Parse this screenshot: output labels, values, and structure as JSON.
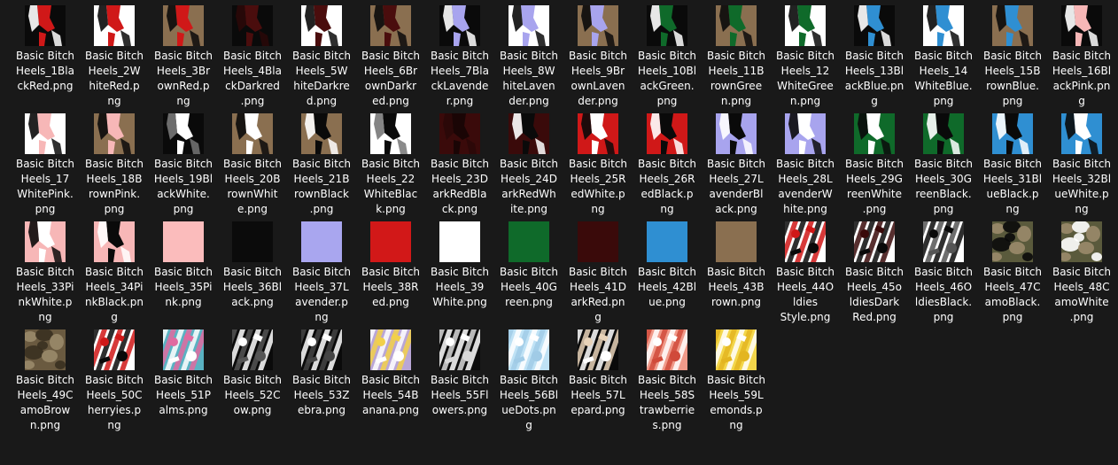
{
  "files": [
    {
      "name": "Basic Bitch Heels_1BlackRed.png",
      "lines": [
        "Basic Bitch",
        "Heels_1Bla",
        "ckRed.png"
      ],
      "thumb": {
        "kind": "shoe",
        "bg": "#0a0a0a",
        "a": "#d01818",
        "b": "#ffffff"
      }
    },
    {
      "name": "Basic Bitch Heels_2WhiteRed.png",
      "lines": [
        "Basic Bitch",
        "Heels_2W",
        "hiteRed.p",
        "ng"
      ],
      "thumb": {
        "kind": "shoe",
        "bg": "#ffffff",
        "a": "#d01818",
        "b": "#0a0a0a"
      }
    },
    {
      "name": "Basic Bitch Heels_3BrownRed.png",
      "lines": [
        "Basic Bitch",
        "Heels_3Br",
        "ownRed.p",
        "ng"
      ],
      "thumb": {
        "kind": "shoe",
        "bg": "#8a6f50",
        "a": "#d01818",
        "b": "#0a0a0a"
      }
    },
    {
      "name": "Basic Bitch Heels_4BlackDarkred.png",
      "lines": [
        "Basic Bitch",
        "Heels_4Bla",
        "ckDarkred",
        ".png"
      ],
      "thumb": {
        "kind": "shoe",
        "bg": "#0a0a0a",
        "a": "#4a0d0d",
        "b": "#2a0808"
      }
    },
    {
      "name": "Basic Bitch Heels_5WhiteDarkred.png",
      "lines": [
        "Basic Bitch",
        "Heels_5W",
        "hiteDarkre",
        "d.png"
      ],
      "thumb": {
        "kind": "shoe",
        "bg": "#ffffff",
        "a": "#4a0d0d",
        "b": "#0a0a0a"
      }
    },
    {
      "name": "Basic Bitch Heels_6BrownDarkred.png",
      "lines": [
        "Basic Bitch",
        "Heels_6Br",
        "ownDarkr",
        "ed.png"
      ],
      "thumb": {
        "kind": "shoe",
        "bg": "#8a6f50",
        "a": "#4a0d0d",
        "b": "#0a0a0a"
      }
    },
    {
      "name": "Basic Bitch Heels_7BlackLavender.png",
      "lines": [
        "Basic Bitch",
        "Heels_7Bla",
        "ckLavende",
        "r.png"
      ],
      "thumb": {
        "kind": "shoe",
        "bg": "#0a0a0a",
        "a": "#a8a4ee",
        "b": "#ffffff"
      }
    },
    {
      "name": "Basic Bitch Heels_8WhiteLavender.png",
      "lines": [
        "Basic Bitch",
        "Heels_8W",
        "hiteLaven",
        "der.png"
      ],
      "thumb": {
        "kind": "shoe",
        "bg": "#ffffff",
        "a": "#a8a4ee",
        "b": "#0a0a0a"
      }
    },
    {
      "name": "Basic Bitch Heels_9BrownLavender.png",
      "lines": [
        "Basic Bitch",
        "Heels_9Br",
        "ownLaven",
        "der.png"
      ],
      "thumb": {
        "kind": "shoe",
        "bg": "#8a6f50",
        "a": "#a8a4ee",
        "b": "#0a0a0a"
      }
    },
    {
      "name": "Basic Bitch Heels_10BlackGreen.png",
      "lines": [
        "Basic Bitch",
        "Heels_10Bl",
        "ackGreen.",
        "png"
      ],
      "thumb": {
        "kind": "shoe",
        "bg": "#0a0a0a",
        "a": "#0f6a2a",
        "b": "#ffffff"
      }
    },
    {
      "name": "Basic Bitch Heels_11BrownGreen.png",
      "lines": [
        "Basic Bitch",
        "Heels_11B",
        "rownGree",
        "n.png"
      ],
      "thumb": {
        "kind": "shoe",
        "bg": "#8a6f50",
        "a": "#0f6a2a",
        "b": "#0a0a0a"
      }
    },
    {
      "name": "Basic Bitch Heels_12WhiteGreen.png",
      "lines": [
        "Basic Bitch",
        "Heels_12",
        "WhiteGree",
        "n.png"
      ],
      "thumb": {
        "kind": "shoe",
        "bg": "#ffffff",
        "a": "#0f6a2a",
        "b": "#0a0a0a"
      }
    },
    {
      "name": "Basic Bitch Heels_13BlackBlue.png",
      "lines": [
        "Basic Bitch",
        "Heels_13Bl",
        "ackBlue.pn",
        "g"
      ],
      "thumb": {
        "kind": "shoe",
        "bg": "#0a0a0a",
        "a": "#2f8fd2",
        "b": "#ffffff"
      }
    },
    {
      "name": "Basic Bitch Heels_14WhiteBlue.png",
      "lines": [
        "Basic Bitch",
        "Heels_14",
        "WhiteBlue.",
        "png"
      ],
      "thumb": {
        "kind": "shoe",
        "bg": "#ffffff",
        "a": "#2f8fd2",
        "b": "#0a0a0a"
      }
    },
    {
      "name": "Basic Bitch Heels_15BrownBlue.png",
      "lines": [
        "Basic Bitch",
        "Heels_15B",
        "rownBlue.",
        "png"
      ],
      "thumb": {
        "kind": "shoe",
        "bg": "#8a6f50",
        "a": "#2f8fd2",
        "b": "#0a0a0a"
      }
    },
    {
      "name": "Basic Bitch Heels_16BlackPink.png",
      "lines": [
        "Basic Bitch",
        "Heels_16Bl",
        "ackPink.pn",
        "g"
      ],
      "thumb": {
        "kind": "shoe",
        "bg": "#0a0a0a",
        "a": "#f7b7b7",
        "b": "#ffffff"
      }
    },
    {
      "name": "Basic Bitch Heels_17WhitePink.png",
      "lines": [
        "Basic Bitch",
        "Heels_17",
        "WhitePink.",
        "png"
      ],
      "thumb": {
        "kind": "shoe",
        "bg": "#ffffff",
        "a": "#f7b7b7",
        "b": "#0a0a0a"
      }
    },
    {
      "name": "Basic Bitch Heels_18BrownPink.png",
      "lines": [
        "Basic Bitch",
        "Heels_18B",
        "rownPink.",
        "png"
      ],
      "thumb": {
        "kind": "shoe",
        "bg": "#8a6f50",
        "a": "#f7b7b7",
        "b": "#0a0a0a"
      }
    },
    {
      "name": "Basic Bitch Heels_19BlackWhite.png",
      "lines": [
        "Basic Bitch",
        "Heels_19Bl",
        "ackWhite.",
        "png"
      ],
      "thumb": {
        "kind": "shoe",
        "bg": "#0a0a0a",
        "a": "#ffffff",
        "b": "#777777"
      }
    },
    {
      "name": "Basic Bitch Heels_20BrownWhite.png",
      "lines": [
        "Basic Bitch",
        "Heels_20B",
        "rownWhit",
        "e.png"
      ],
      "thumb": {
        "kind": "shoe",
        "bg": "#8a6f50",
        "a": "#ffffff",
        "b": "#0a0a0a"
      }
    },
    {
      "name": "Basic Bitch Heels_21BrownBlack.png",
      "lines": [
        "Basic Bitch",
        "Heels_21B",
        "rownBlack",
        ".png"
      ],
      "thumb": {
        "kind": "shoe",
        "bg": "#8a6f50",
        "a": "#0a0a0a",
        "b": "#ffffff"
      }
    },
    {
      "name": "Basic Bitch Heels_22WhiteBlack.png",
      "lines": [
        "Basic Bitch",
        "Heels_22",
        "WhiteBlac",
        "k.png"
      ],
      "thumb": {
        "kind": "shoe",
        "bg": "#ffffff",
        "a": "#0a0a0a",
        "b": "#777777"
      }
    },
    {
      "name": "Basic Bitch Heels_23DarkRedBlack.png",
      "lines": [
        "Basic Bitch",
        "Heels_23D",
        "arkRedBla",
        "ck.png"
      ],
      "thumb": {
        "kind": "shoe",
        "bg": "#3a0a0a",
        "a": "#1a0505",
        "b": "#2a0808"
      }
    },
    {
      "name": "Basic Bitch Heels_24DarkRedWhite.png",
      "lines": [
        "Basic Bitch",
        "Heels_24D",
        "arkRedWh",
        "ite.png"
      ],
      "thumb": {
        "kind": "shoe",
        "bg": "#3a0a0a",
        "a": "#0a0a0a",
        "b": "#ffffff"
      }
    },
    {
      "name": "Basic Bitch Heels_25RedWhite.png",
      "lines": [
        "Basic Bitch",
        "Heels_25R",
        "edWhite.p",
        "ng"
      ],
      "thumb": {
        "kind": "shoe",
        "bg": "#d01818",
        "a": "#ffffff",
        "b": "#0a0a0a"
      }
    },
    {
      "name": "Basic Bitch Heels_26RedBlack.png",
      "lines": [
        "Basic Bitch",
        "Heels_26R",
        "edBlack.p",
        "ng"
      ],
      "thumb": {
        "kind": "shoe",
        "bg": "#d01818",
        "a": "#0a0a0a",
        "b": "#ffffff"
      }
    },
    {
      "name": "Basic Bitch Heels_27LavenderBlack.png",
      "lines": [
        "Basic Bitch",
        "Heels_27L",
        "avenderBl",
        "ack.png"
      ],
      "thumb": {
        "kind": "shoe",
        "bg": "#a8a4ee",
        "a": "#0a0a0a",
        "b": "#ffffff"
      }
    },
    {
      "name": "Basic Bitch Heels_28LavenderWhite.png",
      "lines": [
        "Basic Bitch",
        "Heels_28L",
        "avenderW",
        "hite.png"
      ],
      "thumb": {
        "kind": "shoe",
        "bg": "#a8a4ee",
        "a": "#ffffff",
        "b": "#0a0a0a"
      }
    },
    {
      "name": "Basic Bitch Heels_29GreenWhite.png",
      "lines": [
        "Basic Bitch",
        "Heels_29G",
        "reenWhite",
        ".png"
      ],
      "thumb": {
        "kind": "shoe",
        "bg": "#0f6a2a",
        "a": "#ffffff",
        "b": "#0a0a0a"
      }
    },
    {
      "name": "Basic Bitch Heels_30GreenBlack.png",
      "lines": [
        "Basic Bitch",
        "Heels_30G",
        "reenBlack.",
        "png"
      ],
      "thumb": {
        "kind": "shoe",
        "bg": "#0f6a2a",
        "a": "#0a0a0a",
        "b": "#ffffff"
      }
    },
    {
      "name": "Basic Bitch Heels_31BlueBlack.png",
      "lines": [
        "Basic Bitch",
        "Heels_31Bl",
        "ueBlack.p",
        "ng"
      ],
      "thumb": {
        "kind": "shoe",
        "bg": "#2f8fd2",
        "a": "#0a0a0a",
        "b": "#ffffff"
      }
    },
    {
      "name": "Basic Bitch Heels_32BlueWhite.png",
      "lines": [
        "Basic Bitch",
        "Heels_32Bl",
        "ueWhite.p",
        "ng"
      ],
      "thumb": {
        "kind": "shoe",
        "bg": "#2f8fd2",
        "a": "#ffffff",
        "b": "#0a0a0a"
      }
    },
    {
      "name": "Basic Bitch Heels_33PinkWhite.png",
      "lines": [
        "Basic Bitch",
        "Heels_33Pi",
        "nkWhite.p",
        "ng"
      ],
      "thumb": {
        "kind": "shoe",
        "bg": "#f7b7b7",
        "a": "#ffffff",
        "b": "#0a0a0a"
      }
    },
    {
      "name": "Basic Bitch Heels_34PinkBlack.png",
      "lines": [
        "Basic Bitch",
        "Heels_34Pi",
        "nkBlack.pn",
        "g"
      ],
      "thumb": {
        "kind": "shoe",
        "bg": "#f7b7b7",
        "a": "#0a0a0a",
        "b": "#ffffff"
      }
    },
    {
      "name": "Basic Bitch Heels_35Pink.png",
      "lines": [
        "Basic Bitch",
        "Heels_35Pi",
        "nk.png"
      ],
      "thumb": {
        "kind": "solid",
        "bg": "#fbbcbc"
      }
    },
    {
      "name": "Basic Bitch Heels_36Black.png",
      "lines": [
        "Basic Bitch",
        "Heels_36Bl",
        "ack.png"
      ],
      "thumb": {
        "kind": "solid",
        "bg": "#0b0b0b"
      }
    },
    {
      "name": "Basic Bitch Heels_37Lavender.png",
      "lines": [
        "Basic Bitch",
        "Heels_37L",
        "avender.p",
        "ng"
      ],
      "thumb": {
        "kind": "solid",
        "bg": "#a9a6ef"
      }
    },
    {
      "name": "Basic Bitch Heels_38Red.png",
      "lines": [
        "Basic Bitch",
        "Heels_38R",
        "ed.png"
      ],
      "thumb": {
        "kind": "solid",
        "bg": "#d21818"
      }
    },
    {
      "name": "Basic Bitch Heels_39White.png",
      "lines": [
        "Basic Bitch",
        "Heels_39",
        "White.png"
      ],
      "thumb": {
        "kind": "solid",
        "bg": "#ffffff"
      }
    },
    {
      "name": "Basic Bitch Heels_40Green.png",
      "lines": [
        "Basic Bitch",
        "Heels_40G",
        "reen.png"
      ],
      "thumb": {
        "kind": "solid",
        "bg": "#0f6a2a"
      }
    },
    {
      "name": "Basic Bitch Heels_41DarkRed.png",
      "lines": [
        "Basic Bitch",
        "Heels_41D",
        "arkRed.pn",
        "g"
      ],
      "thumb": {
        "kind": "solid",
        "bg": "#3a0a0a"
      }
    },
    {
      "name": "Basic Bitch Heels_42Blue.png",
      "lines": [
        "Basic Bitch",
        "Heels_42Bl",
        "ue.png"
      ],
      "thumb": {
        "kind": "solid",
        "bg": "#2f8fd2"
      }
    },
    {
      "name": "Basic Bitch Heels_43Brown.png",
      "lines": [
        "Basic Bitch",
        "Heels_43B",
        "rown.png"
      ],
      "thumb": {
        "kind": "solid",
        "bg": "#8a6f50"
      }
    },
    {
      "name": "Basic Bitch Heels_44Oldies Style.png",
      "lines": [
        "Basic Bitch",
        "Heels_44O",
        "ldies",
        "Style.png"
      ],
      "thumb": {
        "kind": "pattern",
        "bg": "#ffffff",
        "a": "#d01818",
        "b": "#0a0a0a"
      }
    },
    {
      "name": "Basic Bitch Heels_45oldiesDarkRed.png",
      "lines": [
        "Basic Bitch",
        "Heels_45o",
        "ldiesDark",
        "Red.png"
      ],
      "thumb": {
        "kind": "pattern",
        "bg": "#ffffff",
        "a": "#3a0a0a",
        "b": "#0a0a0a"
      }
    },
    {
      "name": "Basic Bitch Heels_46OldiesBlack.png",
      "lines": [
        "Basic Bitch",
        "Heels_46O",
        "ldiesBlack.",
        "png"
      ],
      "thumb": {
        "kind": "pattern",
        "bg": "#ffffff",
        "a": "#0a0a0a",
        "b": "#555555"
      }
    },
    {
      "name": "Basic Bitch Heels_47CamoBlack.png",
      "lines": [
        "Basic Bitch",
        "Heels_47C",
        "amoBlack.",
        "png"
      ],
      "thumb": {
        "kind": "camo",
        "bg": "#5a5a3c",
        "a": "#0a0a0a",
        "b": "#9a8a6a"
      }
    },
    {
      "name": "Basic Bitch Heels_48CamoWhite.png",
      "lines": [
        "Basic Bitch",
        "Heels_48C",
        "amoWhite",
        ".png"
      ],
      "thumb": {
        "kind": "camo",
        "bg": "#5a5a3c",
        "a": "#ffffff",
        "b": "#9a8a6a"
      }
    },
    {
      "name": "Basic Bitch Heels_49CamoBrown.png",
      "lines": [
        "Basic Bitch",
        "Heels_49C",
        "amoBrow",
        "n.png"
      ],
      "thumb": {
        "kind": "camo",
        "bg": "#6a5a40",
        "a": "#3a3020",
        "b": "#9a8a6a"
      }
    },
    {
      "name": "Basic Bitch Heels_50Cherryies.png",
      "lines": [
        "Basic Bitch",
        "Heels_50C",
        "herryies.p",
        "ng"
      ],
      "thumb": {
        "kind": "pattern",
        "bg": "#ffffff",
        "a": "#d01818",
        "b": "#0a0a0a"
      }
    },
    {
      "name": "Basic Bitch Heels_51Palms.png",
      "lines": [
        "Basic Bitch",
        "Heels_51P",
        "alms.png"
      ],
      "thumb": {
        "kind": "pattern",
        "bg": "#5ab2c2",
        "a": "#e06aa0",
        "b": "#ffffff"
      }
    },
    {
      "name": "Basic Bitch Heels_52Cow.png",
      "lines": [
        "Basic Bitch",
        "Heels_52C",
        "ow.png"
      ],
      "thumb": {
        "kind": "pattern",
        "bg": "#0a0a0a",
        "a": "#ffffff",
        "b": "#555555"
      }
    },
    {
      "name": "Basic Bitch Heels_53Zebra.png",
      "lines": [
        "Basic Bitch",
        "Heels_53Z",
        "ebra.png"
      ],
      "thumb": {
        "kind": "pattern",
        "bg": "#0a0a0a",
        "a": "#ffffff",
        "b": "#444444"
      }
    },
    {
      "name": "Basic Bitch Heels_54Banana.png",
      "lines": [
        "Basic Bitch",
        "Heels_54B",
        "anana.png"
      ],
      "thumb": {
        "kind": "pattern",
        "bg": "#b9a6d6",
        "a": "#f2d04a",
        "b": "#ffffff"
      }
    },
    {
      "name": "Basic Bitch Heels_55Flowers.png",
      "lines": [
        "Basic Bitch",
        "Heels_55Fl",
        "owers.png"
      ],
      "thumb": {
        "kind": "pattern",
        "bg": "#0a0a0a",
        "a": "#ffffff",
        "b": "#d8d8d8"
      }
    },
    {
      "name": "Basic Bitch Heels_56BlueDots.png",
      "lines": [
        "Basic Bitch",
        "Heels_56Bl",
        "ueDots.pn",
        "g"
      ],
      "thumb": {
        "kind": "pattern",
        "bg": "#bfe2f5",
        "a": "#ffffff",
        "b": "#a0cbe6"
      }
    },
    {
      "name": "Basic Bitch Heels_57Lepard.png",
      "lines": [
        "Basic Bitch",
        "Heels_57L",
        "epard.png"
      ],
      "thumb": {
        "kind": "pattern",
        "bg": "#0a0a0a",
        "a": "#e7d2b8",
        "b": "#ffffff"
      }
    },
    {
      "name": "Basic Bitch Heels_58Strawberries.png",
      "lines": [
        "Basic Bitch",
        "Heels_58S",
        "trawberrie",
        "s.png"
      ],
      "thumb": {
        "kind": "pattern",
        "bg": "#f09a8a",
        "a": "#ffffff",
        "b": "#d04a3a"
      }
    },
    {
      "name": "Basic Bitch Heels_59Lemonds.png",
      "lines": [
        "Basic Bitch",
        "Heels_59L",
        "emonds.p",
        "ng"
      ],
      "thumb": {
        "kind": "pattern",
        "bg": "#f3d64a",
        "a": "#ffffff",
        "b": "#e3b520"
      }
    }
  ]
}
